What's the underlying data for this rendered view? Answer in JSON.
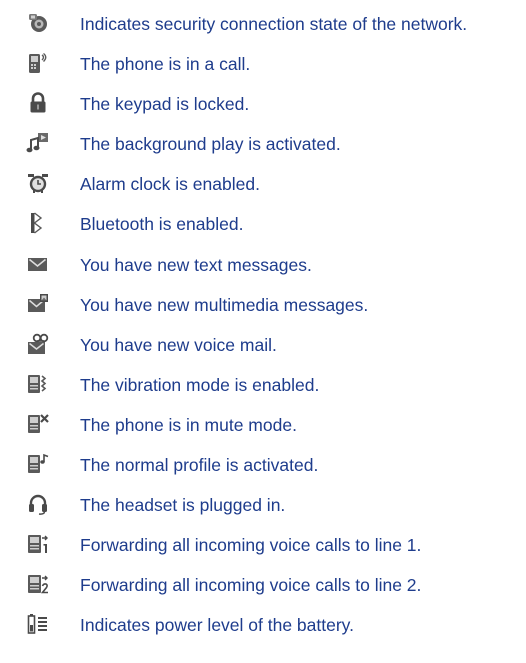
{
  "colors": {
    "text": "#1e3c8c",
    "icon": "#4a4a4a"
  },
  "status_icons": [
    {
      "icon": "network-security-icon",
      "description": "Indicates security connection state of the network."
    },
    {
      "icon": "in-call-icon",
      "description": "The phone is in a call."
    },
    {
      "icon": "keypad-lock-icon",
      "description": "The keypad is locked."
    },
    {
      "icon": "background-play-icon",
      "description": "The background play is activated."
    },
    {
      "icon": "alarm-clock-icon",
      "description": "Alarm clock is enabled."
    },
    {
      "icon": "bluetooth-icon",
      "description": "Bluetooth is enabled."
    },
    {
      "icon": "text-message-icon",
      "description": "You have new text messages."
    },
    {
      "icon": "multimedia-message-icon",
      "description": "You have new multimedia messages."
    },
    {
      "icon": "voice-mail-icon",
      "description": "You have new voice mail."
    },
    {
      "icon": "vibration-mode-icon",
      "description": "The vibration mode is enabled."
    },
    {
      "icon": "mute-mode-icon",
      "description": "The phone is in mute mode."
    },
    {
      "icon": "normal-profile-icon",
      "description": "The normal profile is activated."
    },
    {
      "icon": "headset-icon",
      "description": "The headset is plugged in."
    },
    {
      "icon": "call-forward-line-1-icon",
      "description": "Forwarding all incoming voice calls to line 1."
    },
    {
      "icon": "call-forward-line-2-icon",
      "description": "Forwarding all incoming voice calls to line 2."
    },
    {
      "icon": "battery-level-icon",
      "description": "Indicates power level of the battery."
    }
  ]
}
